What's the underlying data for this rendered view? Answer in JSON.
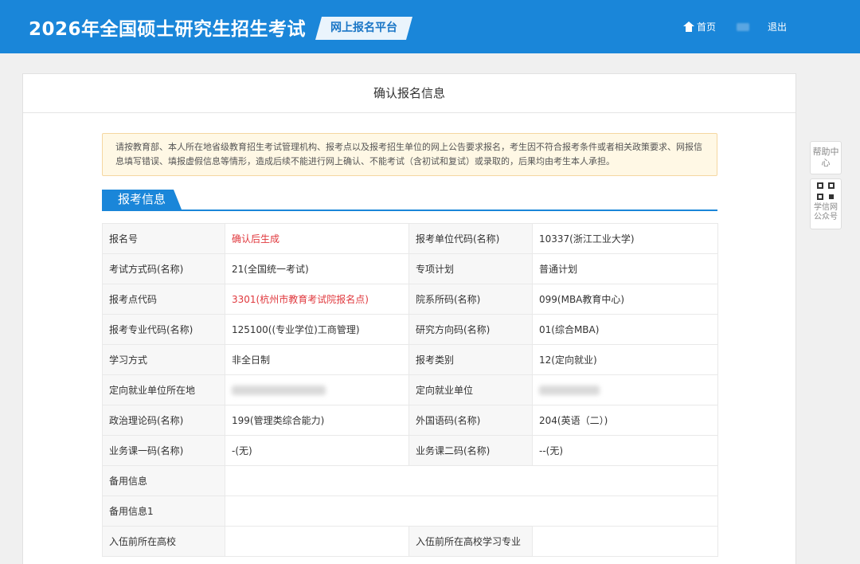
{
  "header": {
    "title": "2026年全国硕士研究生招生考试",
    "platform": "网上报名平台",
    "home": "首页",
    "logout": "退出"
  },
  "panel": {
    "title": "确认报名信息",
    "notice": "请按教育部、本人所在地省级教育招生考试管理机构、报考点以及报考招生单位的网上公告要求报名，考生因不符合报考条件或者相关政策要求、网报信息填写错误、填报虚假信息等情形，造成后续不能进行网上确认、不能考试（含初试和复试）或录取的，后果均由考生本人承担。",
    "section_title": "报考信息"
  },
  "table": {
    "rows": [
      {
        "l1": "报名号",
        "v1": "确认后生成",
        "l2": "报考单位代码(名称)",
        "v2": "10337(浙江工业大学)"
      },
      {
        "l1": "考试方式码(名称)",
        "v1": "21(全国统一考试)",
        "l2": "专项计划",
        "v2": "普通计划"
      },
      {
        "l1": "报考点代码",
        "v1": "3301(杭州市教育考试院报名点)",
        "l2": "院系所码(名称)",
        "v2": "099(MBA教育中心)"
      },
      {
        "l1": "报考专业代码(名称)",
        "v1": "125100((专业学位)工商管理)",
        "l2": "研究方向码(名称)",
        "v2": "01(综合MBA)"
      },
      {
        "l1": "学习方式",
        "v1": "非全日制",
        "l2": "报考类别",
        "v2": "12(定向就业)"
      },
      {
        "l1": "定向就业单位所在地",
        "v1": "",
        "l2": "定向就业单位",
        "v2": ""
      },
      {
        "l1": "政治理论码(名称)",
        "v1": "199(管理类综合能力)",
        "l2": "外国语码(名称)",
        "v2": "204(英语（二）)"
      },
      {
        "l1": "业务课一码(名称)",
        "v1": "-(无)",
        "l2": "业务课二码(名称)",
        "v2": "--(无)"
      },
      {
        "l1": "备用信息",
        "v1": ""
      },
      {
        "l1": "备用信息1",
        "v1": ""
      },
      {
        "l1": "入伍前所在高校",
        "v1": "",
        "l2": "入伍前所在高校学习专业",
        "v2": ""
      }
    ]
  },
  "side": {
    "help": "帮助中心",
    "qr_label": "学信网公众号"
  },
  "colors": {
    "brand": "#1a86d9",
    "highlight_text": "#e0383d"
  }
}
